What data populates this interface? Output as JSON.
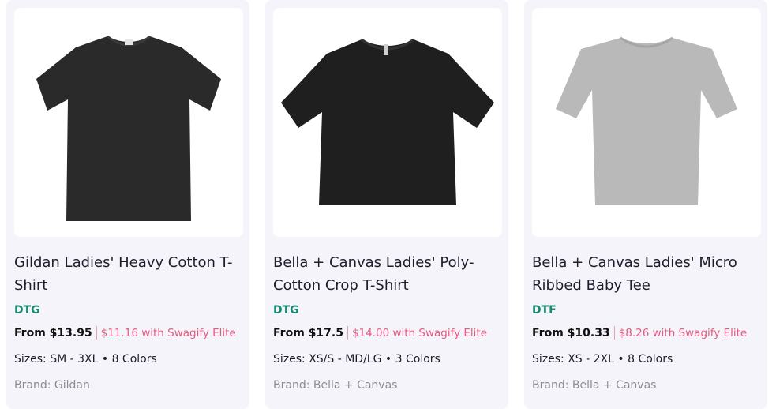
{
  "products": [
    {
      "title": "Gildan Ladies' Heavy Cotton T-Shirt",
      "print_method": "DTG",
      "price": "From $13.95",
      "elite_price": "$11.16 with Swagify Elite",
      "sizes": "Sizes: SM - 3XL • 8 Colors",
      "brand": "Brand: Gildan",
      "image": {
        "icon": "black-tshirt-image",
        "color": "#2a2a2a"
      }
    },
    {
      "title": "Bella + Canvas Ladies' Poly-Cotton Crop T-Shirt",
      "print_method": "DTG",
      "price": "From $17.5",
      "elite_price": "$14.00 with Swagify Elite",
      "sizes": "Sizes: XS/S - MD/LG • 3 Colors",
      "brand": "Brand: Bella + Canvas",
      "image": {
        "icon": "black-crop-tshirt-image",
        "color": "#1f1f1f"
      }
    },
    {
      "title": "Bella + Canvas Ladies' Micro Ribbed Baby Tee",
      "print_method": "DTF",
      "price": "From $10.33",
      "elite_price": "$8.26 with Swagify Elite",
      "sizes": "Sizes: XS - 2XL • 8 Colors",
      "brand": "Brand: Bella + Canvas",
      "image": {
        "icon": "grey-baby-tee-image",
        "color": "#b9b9b9"
      }
    }
  ],
  "colors": {
    "card_bg": "#f4f4fa",
    "method_green": "#1a8a72",
    "elite_pink": "#e55a7f",
    "brand_grey": "#8b8b94"
  }
}
